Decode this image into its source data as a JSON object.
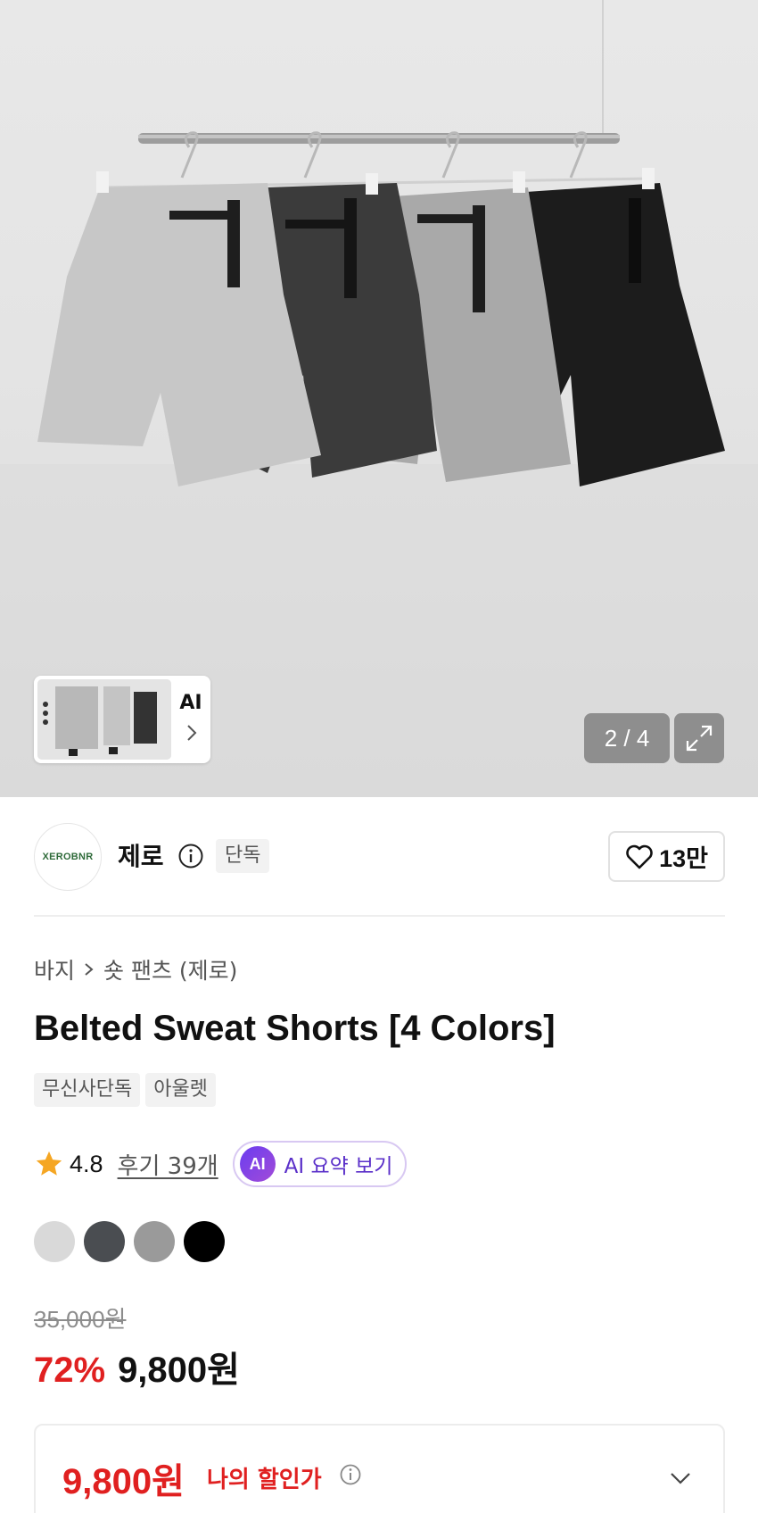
{
  "gallery": {
    "ai_thumb_label": "AI",
    "counter": "2 / 4"
  },
  "seller": {
    "logo_text": "XEROBNR",
    "name": "제로",
    "exclusive_tag": "단독",
    "like_count": "13만"
  },
  "breadcrumb": {
    "category": "바지",
    "subcategory": "숏 팬츠 (제로)"
  },
  "product": {
    "title": "Belted Sweat Shorts [4 Colors]",
    "tags": [
      "무신사단독",
      "아울렛"
    ],
    "rating": "4.8",
    "review_link": "후기 39개",
    "ai_summary_badge": "AI",
    "ai_summary_label": "AI 요약 보기",
    "swatch_colors": [
      "#d9d9d9",
      "#4a4d51",
      "#9a9a9a",
      "#000000"
    ],
    "original_price": "35,000원",
    "discount_rate": "72%",
    "sale_price": "9,800원"
  },
  "my_price": {
    "amount": "9,800원",
    "label": "나의 할인가"
  },
  "colors": {
    "accent_red": "#e02020",
    "ai_purple": "#5a2fc9",
    "star": "#f5a623"
  }
}
